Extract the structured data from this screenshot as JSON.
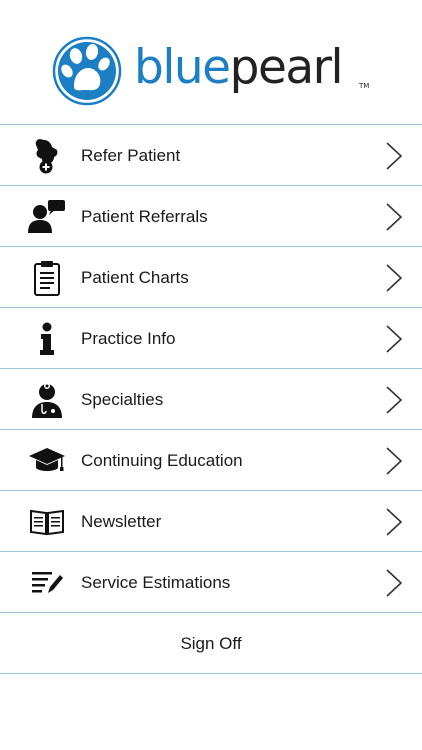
{
  "brand": {
    "name_part1": "blue",
    "name_part2": "pearl",
    "trademark": "TM"
  },
  "menu": {
    "items": [
      {
        "label": "Refer Patient",
        "icon": "dog-plus-icon"
      },
      {
        "label": "Patient Referrals",
        "icon": "person-speech-icon"
      },
      {
        "label": "Patient Charts",
        "icon": "clipboard-icon"
      },
      {
        "label": "Practice Info",
        "icon": "info-icon"
      },
      {
        "label": "Specialties",
        "icon": "doctor-icon"
      },
      {
        "label": "Continuing Education",
        "icon": "graduation-cap-icon"
      },
      {
        "label": "Newsletter",
        "icon": "open-book-icon"
      },
      {
        "label": "Service Estimations",
        "icon": "list-pencil-icon"
      }
    ],
    "sign_off": "Sign Off"
  },
  "colors": {
    "brand_blue": "#1c7fc4",
    "divider": "#9cc6e2",
    "text": "#1a1a1a"
  }
}
